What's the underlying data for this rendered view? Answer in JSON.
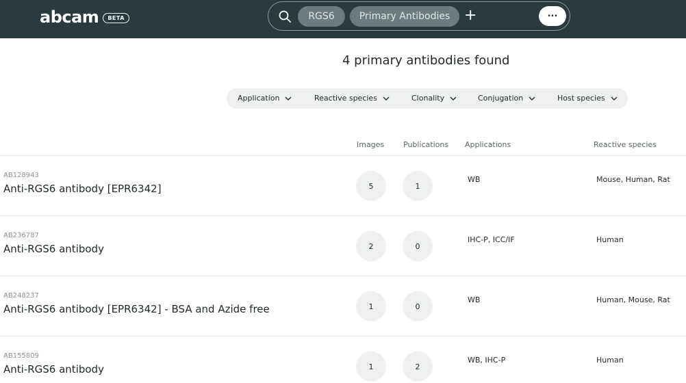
{
  "header": {
    "logo": "abcam",
    "badge": "BETA",
    "search": {
      "chips": [
        "RGS6",
        "Primary Antibodies"
      ],
      "add_label": "+",
      "more_label": "..."
    }
  },
  "results": {
    "title": "4 primary antibodies found"
  },
  "filters": [
    "Application",
    "Reactive species",
    "Clonality",
    "Conjugation",
    "Host species"
  ],
  "table": {
    "columns": {
      "images": "Images",
      "publications": "Publications",
      "applications": "Applications",
      "reactive_species": "Reactive species"
    },
    "rows": [
      {
        "id": "AB128943",
        "name": "Anti-RGS6 antibody [EPR6342]",
        "images": "5",
        "publications": "1",
        "applications": "WB",
        "species": "Mouse, Human, Rat"
      },
      {
        "id": "AB236787",
        "name": "Anti-RGS6 antibody",
        "images": "2",
        "publications": "0",
        "applications": "IHC-P, ICC/IF",
        "species": "Human"
      },
      {
        "id": "AB248237",
        "name": "Anti-RGS6 antibody [EPR6342] - BSA and Azide free",
        "images": "1",
        "publications": "0",
        "applications": "WB",
        "species": "Human, Mouse, Rat"
      },
      {
        "id": "AB155809",
        "name": "Anti-RGS6 antibody",
        "images": "1",
        "publications": "2",
        "applications": "WB, IHC-P",
        "species": "Human"
      }
    ]
  },
  "icons": {
    "search": "search-icon",
    "add": "plus-icon",
    "dropdown": "chevron-down-icon"
  },
  "colors": {
    "header_bg": "#2a3a3e",
    "chip_bg": "#6e7b7e",
    "filter_bg": "#eff1f1"
  }
}
